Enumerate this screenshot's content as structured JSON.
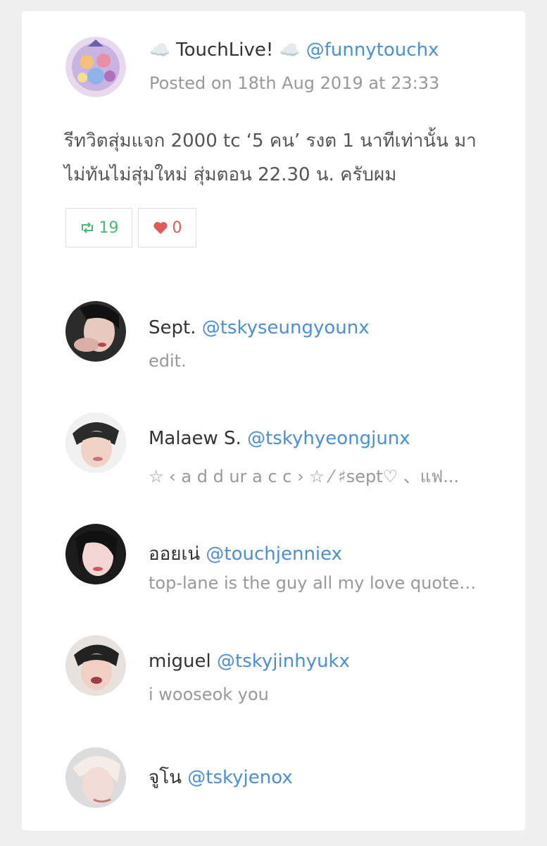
{
  "post": {
    "author_name": "TouchLive!",
    "author_handle": "@funnytouchx",
    "cloud_icon": "☁️",
    "timestamp": "Posted on 18th Aug 2019 at 23:33",
    "text": "รีทวิตสุ่มแจก 2000 tc ‘5 คน’ รงต 1 นาทีเท่านั้น มาไม่ทันไม่สุ่มใหม่ สุ่มตอน 22.30 น. ครับผม",
    "retweet_count": "19",
    "like_count": "0"
  },
  "colors": {
    "handle": "#4a90d9",
    "retweet": "#4cb877",
    "like": "#e05a5a"
  },
  "users": [
    {
      "name": "Sept.",
      "handle": "@tskyseungyounx",
      "bio": "edit."
    },
    {
      "name": "Malaew S.",
      "handle": "@tskyhyeongjunx",
      "bio": "☆ ‹ a d d ur a c c › ☆ ⁄ ♯sept♡ 、แฟ..."
    },
    {
      "name": "ออยเน่",
      "handle": "@touchjenniex",
      "bio": "top-lane is the guy all my love quotes..."
    },
    {
      "name": "miguel",
      "handle": "@tskyjinhyukx",
      "bio": "i wooseok you"
    },
    {
      "name": "จูโน",
      "handle": "@tskyjenox",
      "bio": ""
    }
  ]
}
